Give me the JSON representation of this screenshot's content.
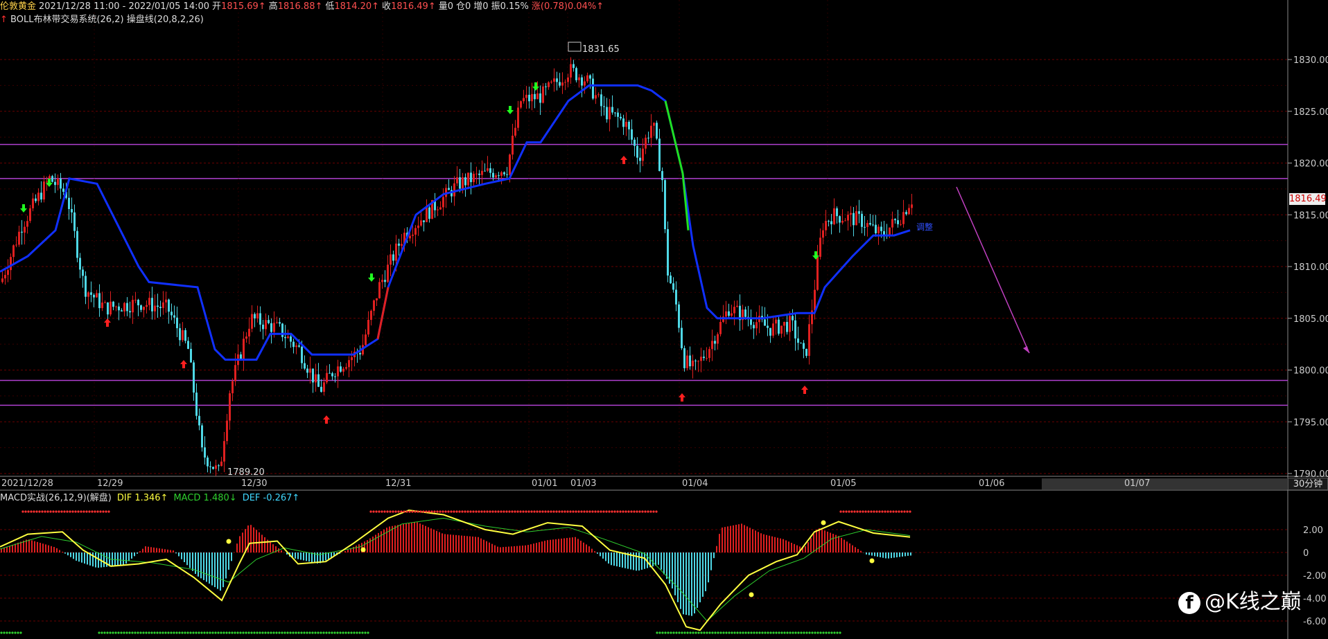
{
  "header": {
    "instrument": "伦敦黄金",
    "range": "2021/12/28 11:00 - 2022/01/05 14:00",
    "open_label": "开",
    "open_value": "1815.69↑",
    "high_label": "高",
    "high_value": "1816.88↑",
    "low_label": "低",
    "low_value": "1814.20↑",
    "close_label": "收",
    "close_value": "1816.49↑",
    "volume": "量0",
    "position": "仓0",
    "increase": "增0",
    "amplitude": "振0.15%",
    "change": "涨(0.78)0.04%↑"
  },
  "indicator": {
    "arrow": "↑",
    "boll": "BOLL布林带交易系统(26,2)",
    "pan": "操盘线(20,8,2,26)"
  },
  "price_axis": [
    "1830.00",
    "1825.00",
    "1820.00",
    "1815.00",
    "1810.00",
    "1805.00",
    "1800.00",
    "1795.00",
    "1790.00"
  ],
  "date_axis": [
    "2021/12/28",
    "12/29",
    "12/30",
    "12/31",
    "01/01",
    "01/03",
    "01/04",
    "01/05",
    "01/06",
    "01/07"
  ],
  "period": "30分钟",
  "annotations": {
    "high": "1831.65",
    "low": "1789.20",
    "note": "调整",
    "last_price": "1816.49"
  },
  "macd": {
    "title": "MACD实战(26,12,9)(解盘)",
    "dif": "DIF 1.346↑",
    "macd": "MACD 1.480↓",
    "def": "DEF -0.267↑",
    "axis": [
      "2.00",
      "0",
      "-2.00",
      "-4.00",
      "-6.00"
    ]
  },
  "watermark": {
    "icon": "f",
    "text": "@K线之巅"
  },
  "colors": {
    "up": "#e02020",
    "down": "#4fd8e6",
    "mid": "#1030ff",
    "dif": "#ffff40",
    "dea": "#2ecf2e",
    "level": "#b040d0",
    "grid": "#6a0000"
  }
}
